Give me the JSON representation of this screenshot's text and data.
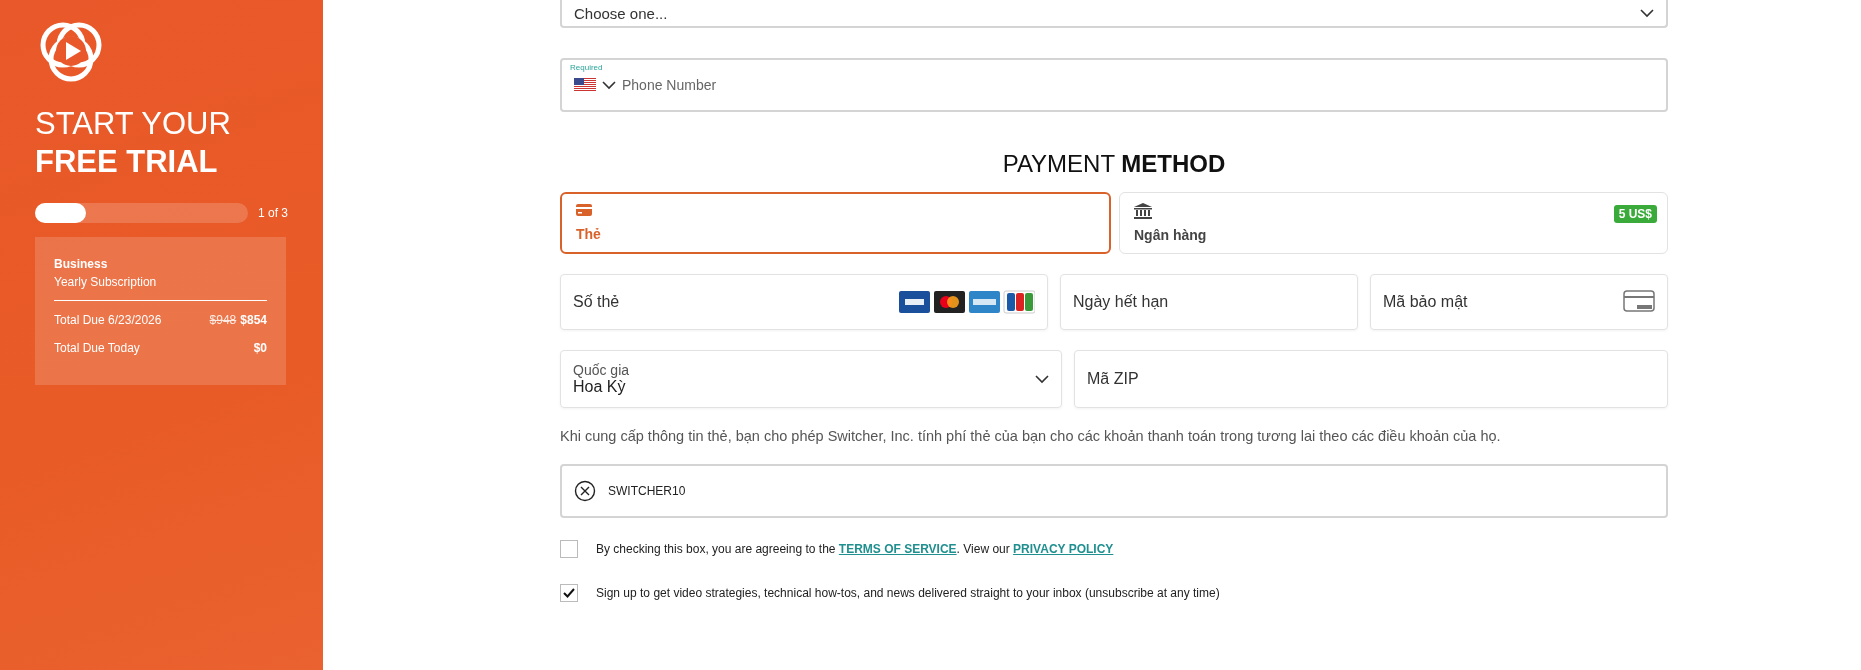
{
  "sidebar": {
    "title_light": "START YOUR",
    "title_bold": "FREE TRIAL",
    "progress": {
      "level": 0.24,
      "label": "1 of 3"
    },
    "plan": {
      "name": "Business",
      "subtitle": "Yearly Subscription",
      "rows": [
        {
          "label": "Total Due 6/23/2026",
          "old_price": "$948",
          "price": "$854"
        },
        {
          "label": "Total Due Today",
          "price": "$0"
        }
      ]
    }
  },
  "form": {
    "select_field": {
      "value": "Choose one..."
    },
    "phone_field": {
      "required_label": "Required",
      "placeholder": "Phone Number"
    },
    "payment_heading": "PAYMENT **METHOD**",
    "payment_methods": [
      {
        "kind": "card",
        "label": "Thẻ",
        "selected": true
      },
      {
        "kind": "bank",
        "label": "Ngân hàng",
        "selected": false,
        "badge": "5 US$"
      }
    ],
    "card_number": {
      "placeholder": "Số thẻ"
    },
    "expiry": {
      "placeholder": "Ngày hết hạn"
    },
    "security_code": {
      "placeholder": "Mã bảo mật"
    },
    "country": {
      "label": "Quốc gia",
      "value": "Hoa Kỳ"
    },
    "zip": {
      "placeholder": "Mã ZIP"
    },
    "disclaimer": "Khi cung cấp thông tin thẻ, bạn cho phép Switcher, Inc. tính phí thẻ của bạn cho các khoản thanh toán trong tương lai theo các điều khoản của họ.",
    "coupon": {
      "value": "SWITCHER10"
    },
    "checkboxes": [
      {
        "checked": false,
        "text": "By checking this box, you are agreeing to the ",
        "link_1": "TERMS OF SERVICE",
        "text_2": ". View our ",
        "link_2": "PRIVACY POLICY"
      },
      {
        "checked": true,
        "text": "Sign up to get video strategies, technical how-tos, and news delivered straight to your inbox (unsubscribe at any time)"
      }
    ]
  }
}
